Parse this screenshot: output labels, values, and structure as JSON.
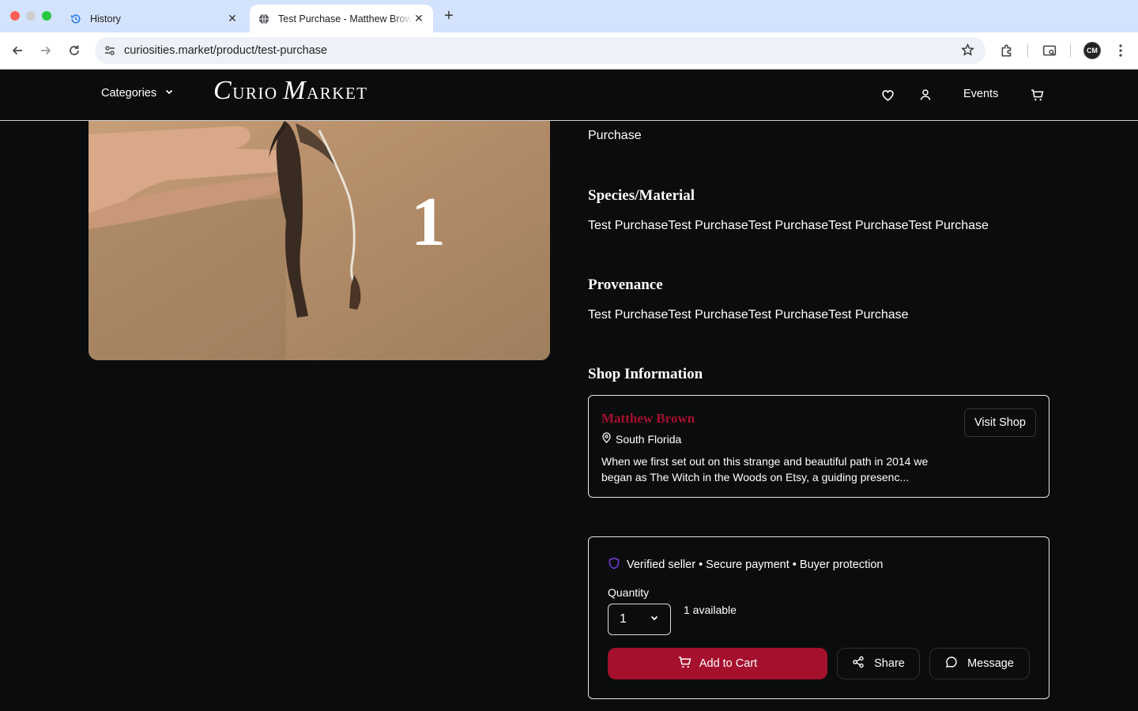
{
  "browser": {
    "tabs": [
      {
        "title": "History",
        "icon": "history-icon",
        "active": false
      },
      {
        "title": "Test Purchase - Matthew Brown",
        "icon": "globe-icon",
        "active": true
      }
    ],
    "url": "curiosities.market/product/test-purchase",
    "profile_initials": "CM"
  },
  "header": {
    "categories_label": "Categories",
    "logo": {
      "c": "C",
      "urio": "URIO",
      "m": "M",
      "arket": "ARKET"
    },
    "events_label": "Events"
  },
  "product": {
    "photo_overlay_number": "1",
    "title_tail": "Purchase",
    "species_heading": "Species/Material",
    "species_text": "Test PurchaseTest PurchaseTest PurchaseTest PurchaseTest Purchase",
    "provenance_heading": "Provenance",
    "provenance_text": "Test PurchaseTest PurchaseTest PurchaseTest Purchase"
  },
  "shop": {
    "heading": "Shop Information",
    "name": "Matthew Brown",
    "location": "South Florida",
    "description": "When we first set out on this strange and beautiful path in 2014 we began as The Witch in the Woods on Etsy, a guiding presenc...",
    "visit_label": "Visit Shop"
  },
  "purchase": {
    "trust_text": "Verified seller • Secure payment • Buyer protection",
    "quantity_label": "Quantity",
    "quantity_value": "1",
    "available_text": "1 available",
    "add_to_cart_label": "Add to Cart",
    "share_label": "Share",
    "message_label": "Message"
  },
  "colors": {
    "accent": "#a5102d",
    "background": "#0b0c0d",
    "tabbar": "#d3e3fd",
    "shield": "#7b3fe4"
  }
}
